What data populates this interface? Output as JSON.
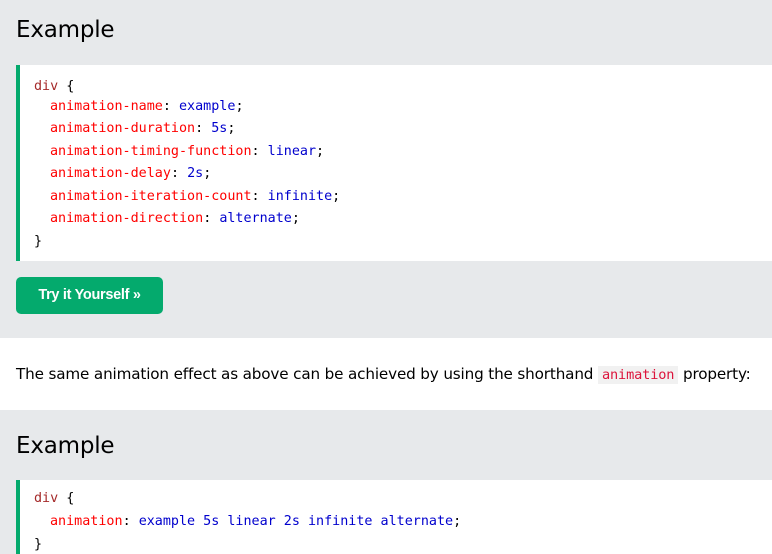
{
  "example1": {
    "heading": "Example",
    "code": {
      "selector": "div",
      "open_brace": " {",
      "close_brace": "}",
      "lines": [
        {
          "prop": "animation-name",
          "value": "example"
        },
        {
          "prop": "animation-duration",
          "value": "5s"
        },
        {
          "prop": "animation-timing-function",
          "value": "linear"
        },
        {
          "prop": "animation-delay",
          "value": "2s"
        },
        {
          "prop": "animation-iteration-count",
          "value": "infinite"
        },
        {
          "prop": "animation-direction",
          "value": "alternate"
        }
      ]
    },
    "button_label": "Try it Yourself »"
  },
  "paragraph": {
    "before": "The same animation effect as above can be achieved by using the shorthand ",
    "code": "animation",
    "after": " property:"
  },
  "example2": {
    "heading": "Example",
    "code": {
      "selector": "div",
      "open_brace": " {",
      "close_brace": "}",
      "lines": [
        {
          "prop": "animation",
          "value": "example 5s linear 2s infinite alternate"
        }
      ]
    }
  },
  "colors": {
    "accent_green": "#04aa6d",
    "box_background": "#e7e9eb",
    "css_selector": "#a52a2a",
    "css_property": "#ff0000",
    "css_value": "#0000cd",
    "inline_code": "#dc143c"
  }
}
